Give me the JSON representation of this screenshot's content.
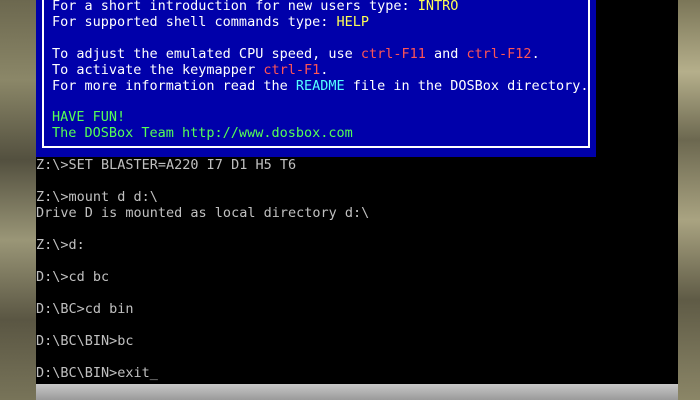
{
  "banner": {
    "intro_prefix": "For a short introduction for new users type: ",
    "intro_cmd": "INTRO",
    "help_prefix": "For supported shell commands type: ",
    "help_cmd": "HELP",
    "cpu_prefix": "To adjust the emulated CPU speed, use ",
    "cpu_key1": "ctrl-F11",
    "cpu_mid": " and ",
    "cpu_key2": "ctrl-F12",
    "cpu_suffix": ".",
    "keymap_prefix": "To activate the keymapper ",
    "keymap_key": "ctrl-F1",
    "keymap_suffix": ".",
    "readme_prefix": "For more information read the ",
    "readme_word": "README",
    "readme_suffix": " file in the DOSBox directory.",
    "have_fun": "HAVE FUN!",
    "team": "The DOSBox Team http://www.dosbox.com"
  },
  "console": {
    "lines": [
      "Z:\\>SET BLASTER=A220 I7 D1 H5 T6",
      "Z:\\>mount d d:\\",
      "Drive D is mounted as local directory d:\\",
      "Z:\\>d:",
      "D:\\>cd bc",
      "D:\\BC>cd bin",
      "D:\\BC\\BIN>bc",
      "D:\\BC\\BIN>exit"
    ],
    "cursor": "_"
  },
  "colors": {
    "banner_bg": "#0000aa",
    "text_white": "#ffffff",
    "text_yellow": "#ffff55",
    "text_red": "#ff5555",
    "text_cyan": "#55ffff",
    "text_green": "#55ff55",
    "console_text": "#c0c0c0"
  }
}
